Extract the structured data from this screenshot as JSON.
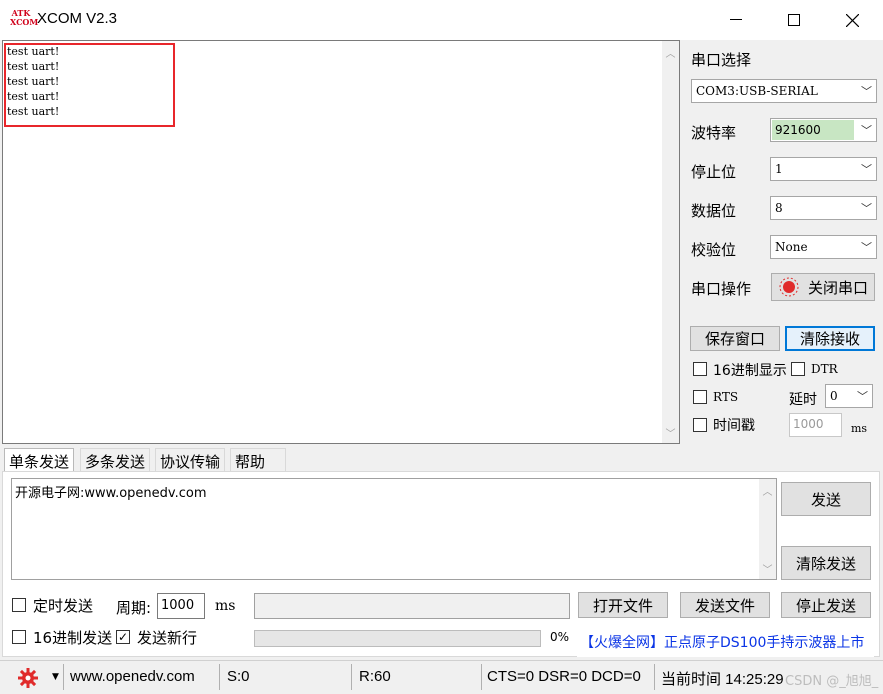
{
  "window": {
    "title": "XCOM V2.3",
    "logo_top": "ATK",
    "logo_bottom": "XCOM"
  },
  "receive": {
    "lines": "test uart!\ntest uart!\ntest uart!\ntest uart!\ntest uart!"
  },
  "port": {
    "select_label": "串口选择",
    "port_value": "COM3:USB-SERIAL",
    "baud_label": "波特率",
    "baud_value": "921600",
    "stop_label": "停止位",
    "stop_value": "1",
    "data_label": "数据位",
    "data_value": "8",
    "parity_label": "校验位",
    "parity_value": "None",
    "op_label": "串口操作",
    "op_button": "关闭串口"
  },
  "recv_buttons": {
    "save": "保存窗口",
    "clear": "清除接收"
  },
  "options": {
    "hex_display": "16进制显示",
    "dtr": "DTR",
    "rts": "RTS",
    "delay_label": "延时",
    "delay_value": "0",
    "timestamp": "时间戳",
    "timestamp_value": "1000",
    "ms": "ms"
  },
  "tabs": [
    "单条发送",
    "多条发送",
    "协议传输",
    "帮助"
  ],
  "send": {
    "text": "开源电子网:www.openedv.com",
    "send_button": "发送",
    "clear_send_button": "清除发送",
    "timed_send": "定时发送",
    "period_label": "周期:",
    "period_value": "1000",
    "period_unit": "ms",
    "hex_send": "16进制发送",
    "newline_send": "发送新行",
    "open_file": "打开文件",
    "send_file": "发送文件",
    "stop_send": "停止发送",
    "progress": "0%",
    "ad_text": "【火爆全网】正点原子DS100手持示波器上市"
  },
  "status": {
    "url": "www.openedv.com",
    "sent": "S:0",
    "received": "R:60",
    "lines": "CTS=0 DSR=0 DCD=0",
    "time": "当前时间 14:25:29",
    "watermark": "CSDN @_旭旭_"
  },
  "colors": {
    "baud_bg": "#c8e6c3",
    "highlight": "#e8262b",
    "ad_blue": "#0b35e6",
    "gear": "#e02b2b"
  }
}
